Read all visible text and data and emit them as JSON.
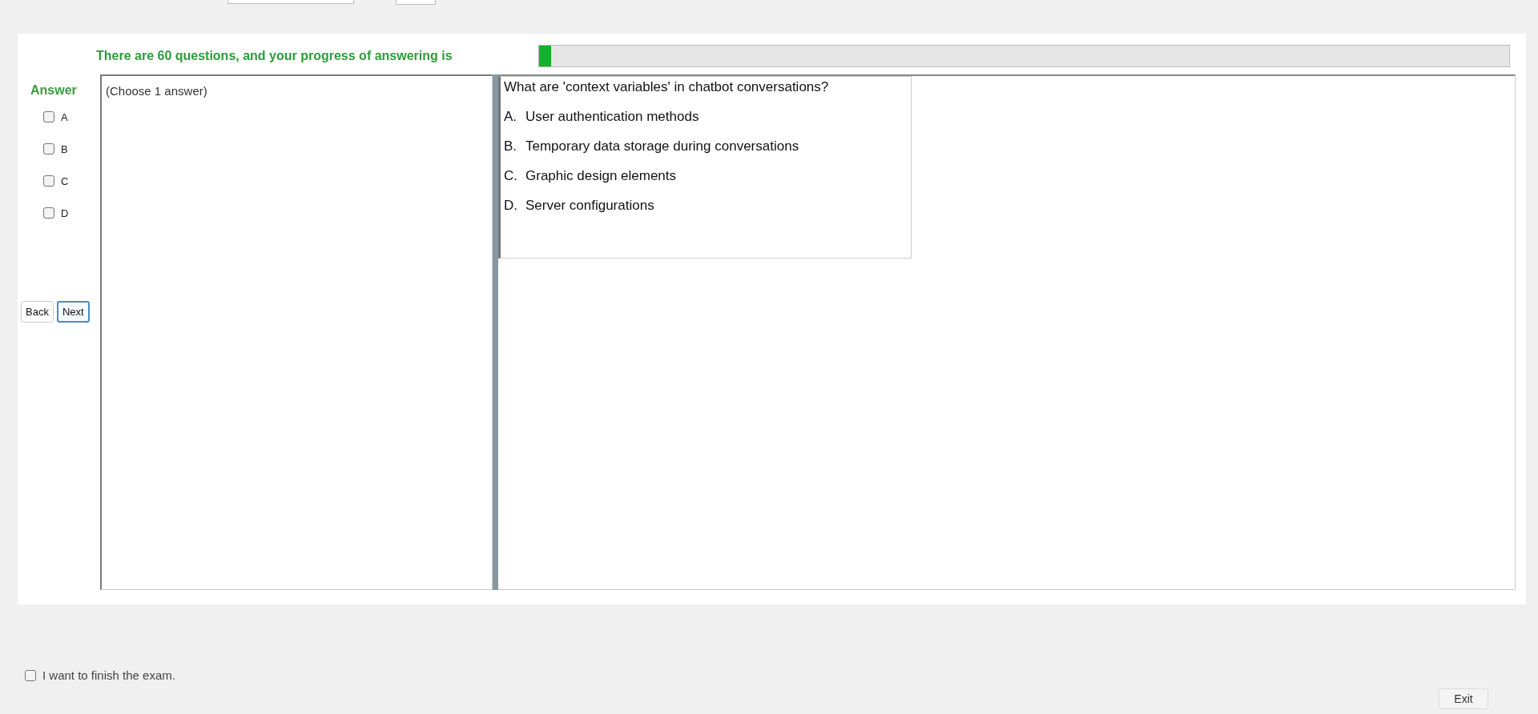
{
  "progress": {
    "label": "There are 60 questions, and your progress of answering is",
    "level": 0.012
  },
  "answer_panel": {
    "title": "Answer",
    "options": [
      {
        "label": "A",
        "checked": false
      },
      {
        "label": "B",
        "checked": false
      },
      {
        "label": "C",
        "checked": false
      },
      {
        "label": "D",
        "checked": false
      }
    ]
  },
  "nav_buttons": [
    {
      "label": "Back",
      "selected": false
    },
    {
      "label": "Next",
      "selected": true
    }
  ],
  "answer_box": {
    "instruction": "(Choose 1 answer)"
  },
  "question": {
    "text": "What are 'context variables' in chatbot conversations?",
    "choices": [
      {
        "letter": "A.",
        "text": "User authentication methods"
      },
      {
        "letter": "B.",
        "text": "Temporary data storage during conversations"
      },
      {
        "letter": "C.",
        "text": "Graphic design elements"
      },
      {
        "letter": "D.",
        "text": "Server configurations"
      }
    ]
  },
  "finish": {
    "label": "I want to finish the exam.",
    "checked": false
  },
  "exit_button": {
    "label": "Exit"
  }
}
